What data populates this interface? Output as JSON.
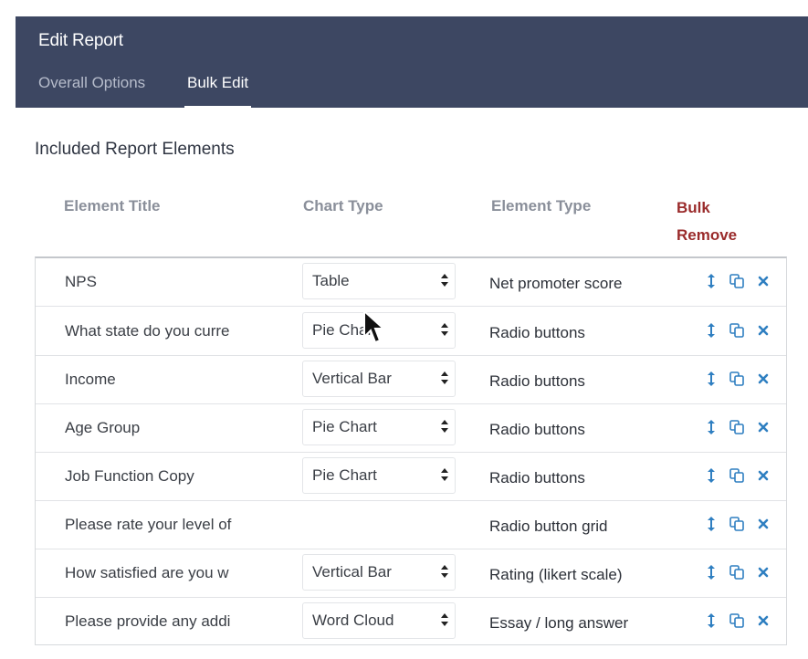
{
  "header": {
    "title": "Edit Report",
    "tabs": [
      {
        "label": "Overall Options",
        "active": false
      },
      {
        "label": "Bulk Edit",
        "active": true
      }
    ]
  },
  "section_title": "Included Report Elements",
  "columns": {
    "element_title": "Element Title",
    "chart_type": "Chart Type",
    "element_type": "Element Type",
    "bulk_line1": "Bulk",
    "bulk_line2": "Remove"
  },
  "colors": {
    "header_bg": "#3d4762",
    "bulk_remove": "#9a2b2b",
    "action_icon": "#2f7fc1"
  },
  "rows": [
    {
      "title": "NPS",
      "chart_type": "Table",
      "element_type": "Net promoter score"
    },
    {
      "title": "What state do you curre",
      "chart_type": "Pie Chart",
      "element_type": "Radio buttons"
    },
    {
      "title": "Income",
      "chart_type": "Vertical Bar",
      "element_type": "Radio buttons"
    },
    {
      "title": "Age Group",
      "chart_type": "Pie Chart",
      "element_type": "Radio buttons"
    },
    {
      "title": "Job Function Copy",
      "chart_type": "Pie Chart",
      "element_type": "Radio buttons"
    },
    {
      "title": "Please rate your level of",
      "chart_type": "",
      "element_type": "Radio button grid"
    },
    {
      "title": "How satisfied are you w",
      "chart_type": "Vertical Bar",
      "element_type": "Rating (likert scale)"
    },
    {
      "title": "Please provide any addi",
      "chart_type": "Word Cloud",
      "element_type": "Essay / long answer"
    }
  ],
  "row_actions": [
    "move-icon",
    "copy-icon",
    "remove-icon"
  ]
}
